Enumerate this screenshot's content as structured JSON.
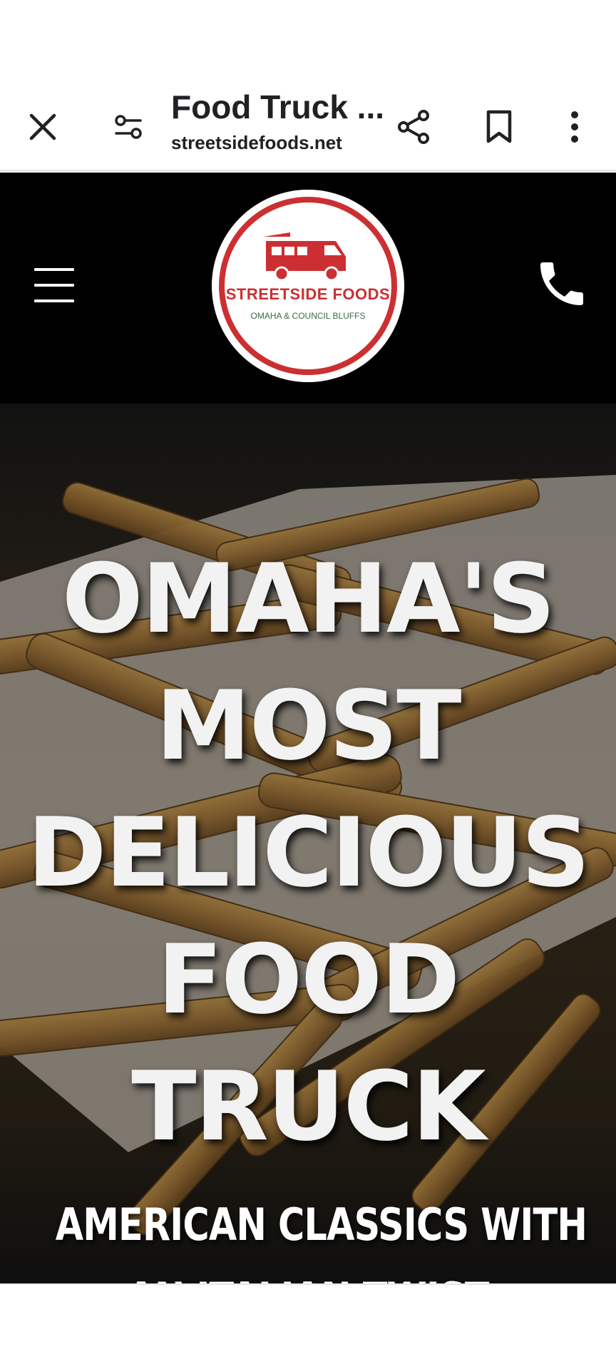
{
  "toolbar": {
    "title": "Food Truck ...",
    "url": "streetsidefoods.net",
    "icons": [
      "close-icon",
      "tune-icon",
      "share-icon",
      "bookmark-icon",
      "more-vert-icon"
    ]
  },
  "site_header": {
    "menu_icon": "hamburger-menu-icon",
    "phone_icon": "phone-icon",
    "logo": {
      "name": "STREETSIDE FOODS",
      "subtitle": "OMAHA & COUNCIL BLUFFS",
      "color": "#cc2f32"
    }
  },
  "hero": {
    "headline_lines": [
      "OMAHA'S",
      "MOST",
      "DELICIOUS",
      "FOOD",
      "TRUCK"
    ],
    "subheadline_lines": [
      "AMERICAN CLASSICS WITH",
      "AN ITALIAN TWIST"
    ]
  }
}
